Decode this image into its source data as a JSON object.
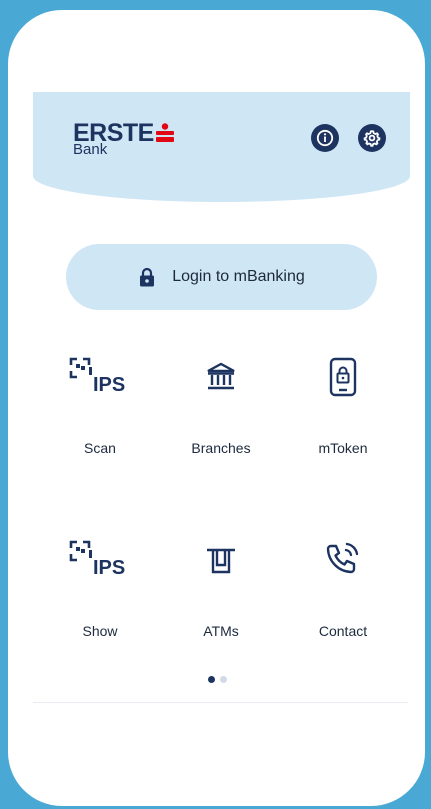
{
  "brand": {
    "name": "ERSTE",
    "sub": "Bank",
    "primary": "#1d3461",
    "accent": "#e30613",
    "header_bg": "#cfe6f5"
  },
  "header": {
    "info_icon": "info-icon",
    "settings_icon": "gear-icon"
  },
  "login": {
    "label": "Login to mBanking",
    "icon": "lock-icon"
  },
  "tiles": [
    {
      "label": "Scan",
      "icon": "ips-scan-icon"
    },
    {
      "label": "Branches",
      "icon": "bank-building-icon"
    },
    {
      "label": "mToken",
      "icon": "mobile-lock-icon"
    },
    {
      "label": "Show",
      "icon": "ips-show-icon"
    },
    {
      "label": "ATMs",
      "icon": "atm-icon"
    },
    {
      "label": "Contact",
      "icon": "phone-call-icon"
    }
  ],
  "pager": {
    "pages": 2,
    "active": 1,
    "active_color": "#1d3461",
    "inactive_color": "#d0dbe6"
  }
}
